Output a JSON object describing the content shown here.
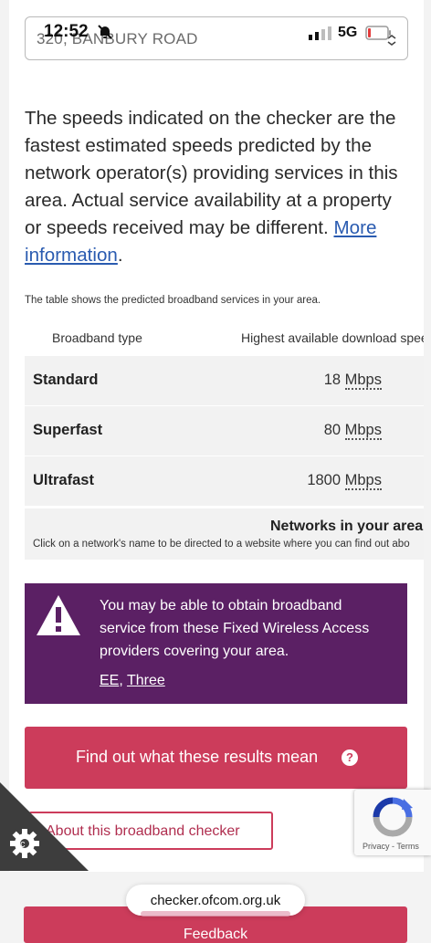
{
  "status_bar": {
    "time": "12:52",
    "network": "5G"
  },
  "address": {
    "value": "320, BANBURY ROAD"
  },
  "intro": {
    "text": "The speeds indicated on the checker are the fastest estimated speeds predicted by the network operator(s) providing services in this area. Actual service availability at a property or speeds received may be different.",
    "link": "More information",
    "end": "."
  },
  "table": {
    "caption": "The table shows the predicted broadband services in your area.",
    "headers": [
      "Broadband type",
      "Highest available download spee"
    ],
    "rows": [
      {
        "type": "Standard",
        "value": "18",
        "unit": "Mbps"
      },
      {
        "type": "Superfast",
        "value": "80",
        "unit": "Mbps"
      },
      {
        "type": "Ultrafast",
        "value": "1800",
        "unit": "Mbps"
      }
    ]
  },
  "networks": {
    "title": "Networks in your area",
    "subtitle": "Click on a network's name to be directed to a website where you can find out abo"
  },
  "alert": {
    "text": "You may be able to obtain broadband service from these Fixed Wireless Access providers covering your area.",
    "providers": [
      "EE",
      "Three"
    ],
    "separator": ", "
  },
  "buttons": {
    "results": "Find out what these results mean",
    "about": "About this broadband checker",
    "feedback": "Feedback"
  },
  "recaptcha": {
    "label": "Privacy - Terms"
  },
  "browser": {
    "url": "checker.ofcom.org.uk"
  },
  "colors": {
    "accent": "#cc3c5b",
    "alert_bg": "#5b2064",
    "link": "#2a5bb0"
  }
}
